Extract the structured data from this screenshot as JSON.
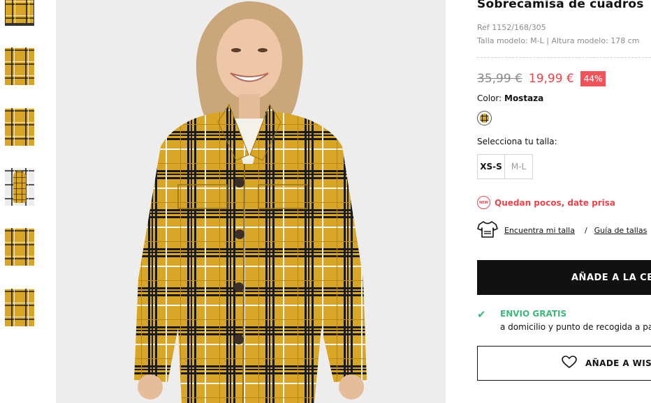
{
  "product": {
    "title": "Sobrecamisa de cuadros",
    "ref": "Ref 1152/168/305",
    "model_info": "Talla modelo: M-L | Altura modelo: 178 cm",
    "old_price": "35,99 €",
    "new_price": "19,99 €",
    "discount": "44%",
    "color_prefix": "Color:",
    "color_name": "Mostaza",
    "size_label": "Selecciona tu talla:",
    "sizes": [
      "XS-S",
      "M-L"
    ],
    "low_stock_badge": "NEW",
    "low_stock": "Quedan pocos, date prisa",
    "find_size": "Encuentra mi talla",
    "separator": "/",
    "size_guide": "Guía de tallas",
    "add_to_cart": "AÑADE A LA CESTA",
    "shipping_title": "ENVIO GRATIS",
    "shipping_sub": "a domicilio y punto de recogida a partir de",
    "wishlist": "AÑADE A WISHLIST"
  },
  "colors": {
    "mustard": "#d9a527",
    "sale_red": "#e8444b",
    "ship_green": "#3fb67b",
    "button_black": "#111111"
  },
  "icons": {
    "tshirt": "tshirt-icon",
    "check": "check-icon",
    "heart": "heart-icon"
  }
}
